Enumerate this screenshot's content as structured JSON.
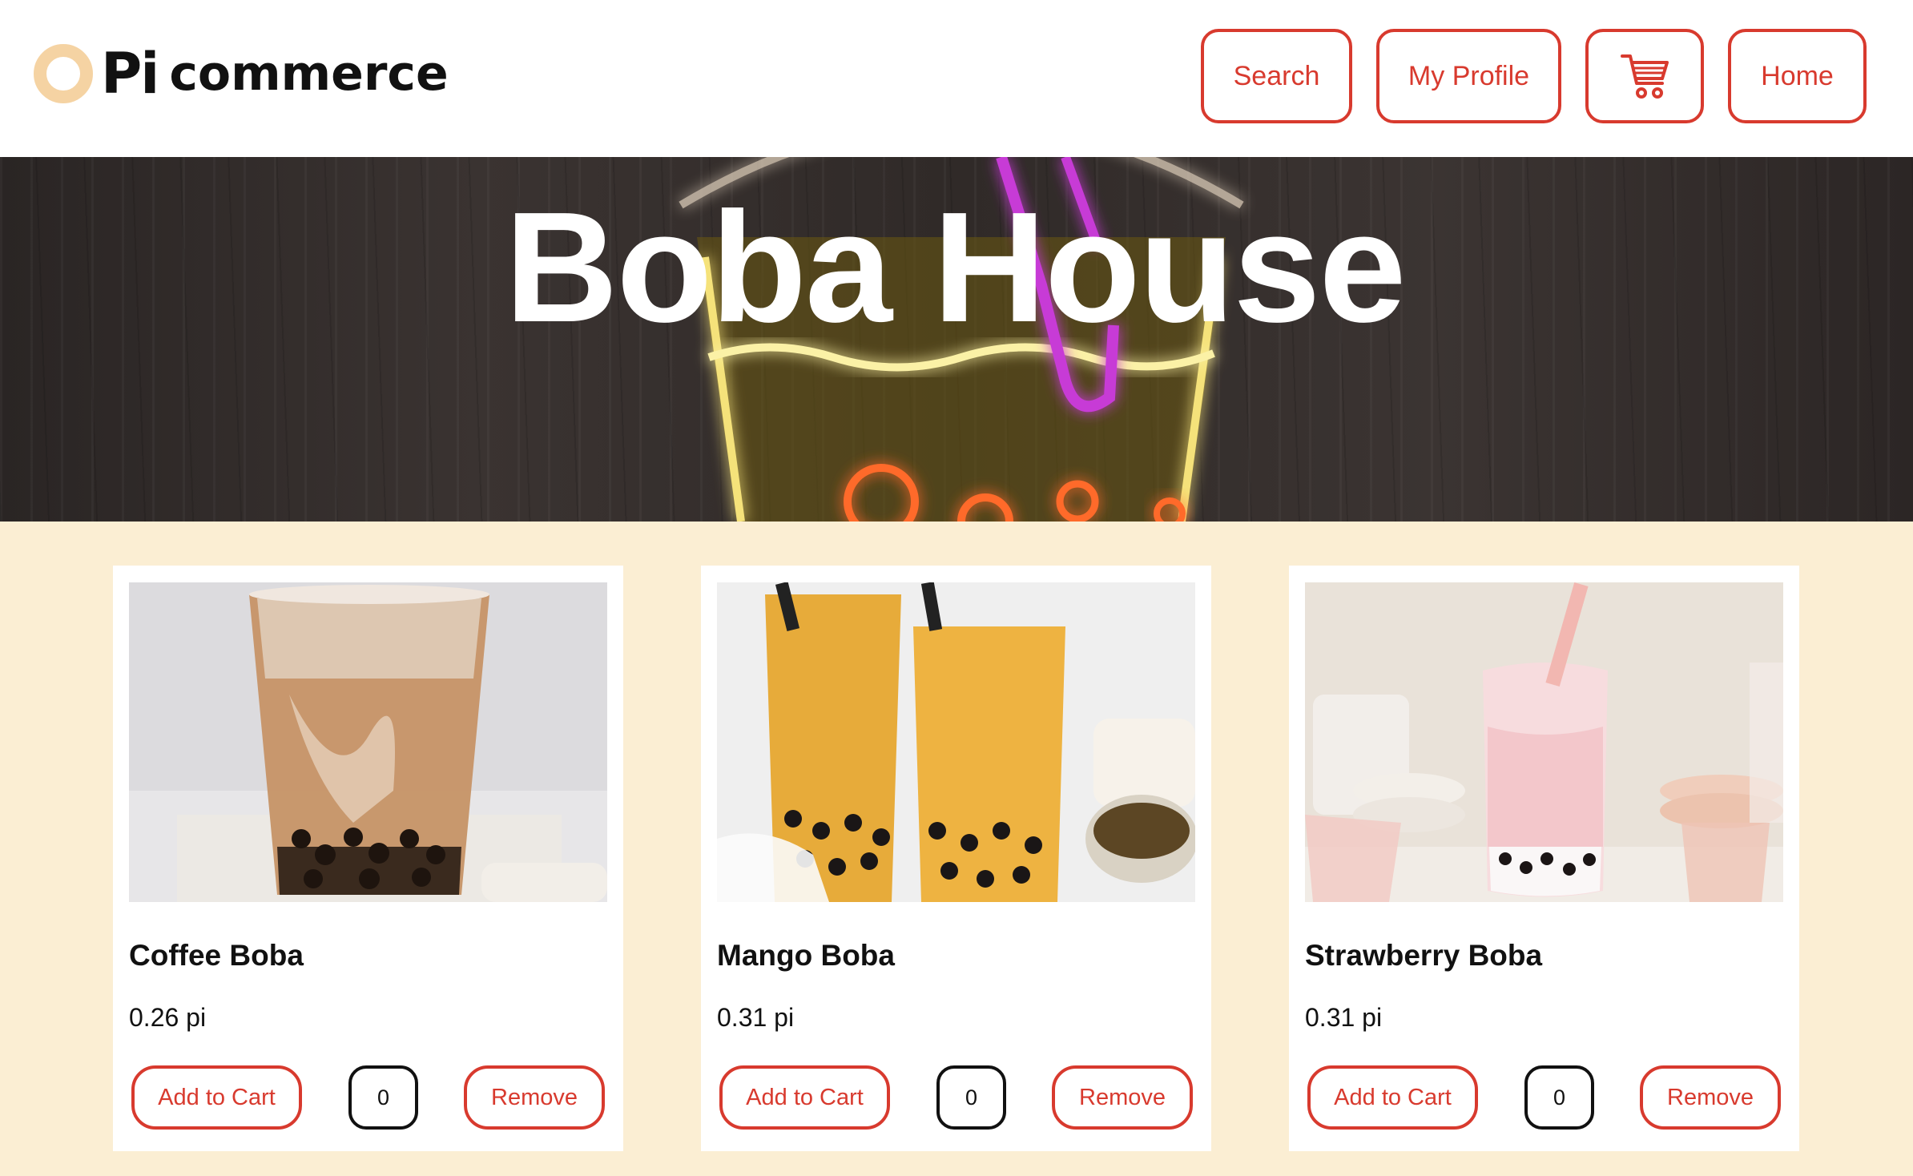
{
  "header": {
    "logo_pi": "Pi",
    "logo_commerce": "commerce",
    "nav": {
      "search": "Search",
      "profile": "My Profile",
      "cart_icon": "shopping-cart-icon",
      "home": "Home"
    }
  },
  "banner": {
    "title": "Boba House"
  },
  "products": [
    {
      "name": "Coffee Boba",
      "price": "0.26 pi",
      "add_label": "Add to Cart",
      "qty": "0",
      "remove_label": "Remove"
    },
    {
      "name": "Mango Boba",
      "price": "0.31 pi",
      "add_label": "Add to Cart",
      "qty": "0",
      "remove_label": "Remove"
    },
    {
      "name": "Strawberry Boba",
      "price": "0.31 pi",
      "add_label": "Add to Cart",
      "qty": "0",
      "remove_label": "Remove"
    }
  ],
  "colors": {
    "accent": "#d83a2e",
    "page_background": "#fbeed3",
    "logo_ring": "#f5d3a3"
  }
}
